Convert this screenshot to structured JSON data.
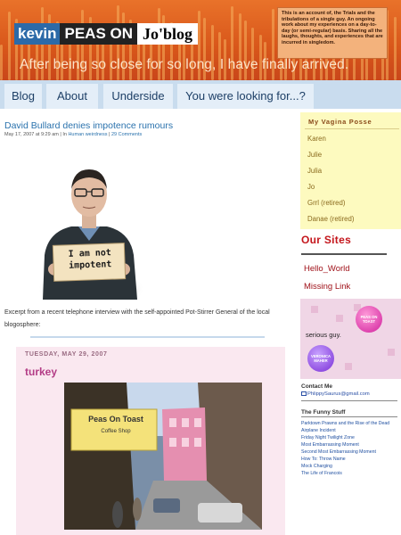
{
  "header": {
    "logo_kevin": "kevin",
    "logo_peas": "PEAS ON",
    "logo_jo": "Jo'blog",
    "tagline": "This is an account of, the Trials and the tribulations of a single guy. An ongoing work about my experiences on a day-to-day (or semi-regular) basis. Sharing all the laughs, thoughts, and experiences that are incurred in singledom.",
    "headline": "After being so close for so long, I have finally arrived."
  },
  "nav": {
    "tabs": [
      "Blog",
      "About",
      "Underside",
      "You were looking for...?"
    ]
  },
  "post": {
    "title": "David Bullard denies impotence rumours",
    "meta_date": "May 17, 2007 at 9:29 am | In ",
    "meta_category": "Human weirdness",
    "meta_sep": " | ",
    "meta_comments": "29 Comments",
    "sign_text": "I am not impotent",
    "excerpt": "Excerpt from a recent telephone interview with the self-appointed Pot-Stirrer General of the local blogosphere:"
  },
  "embed": {
    "date": "TUESDAY, MAY 29, 2007",
    "title": "turkey",
    "shop_sign": "Peas On Toast",
    "shop_sub": "Coffee Shop"
  },
  "sidebar": {
    "posse_title": "My Vagina Posse",
    "posse_items": [
      "Karen",
      "Julie",
      "Julia",
      "Jo",
      "Grrl (retired)",
      "Danae (retired)"
    ],
    "sites_title": "Our Sites",
    "sites": [
      "Hello_World",
      "Missing Link"
    ],
    "ad_text": "serious guy.",
    "badge_top": "PEAS ON TOAST",
    "badge_bottom": "VERONICA MAHER",
    "contact_title": "Contact Me",
    "contact_email": "PhlippySaurus@gmail.com",
    "funny_title": "The Funny Stuff",
    "funny_items": [
      "Parktown Prawns and the Rise of the Dead",
      "Airplane Incident",
      "Friday Night Twilight Zone",
      "Most Embarrassing Moment",
      "Second Most Embarrassing Moment",
      "How To: Throw Name",
      "Mock Charging",
      "The Life of Francois"
    ]
  },
  "colors": {
    "header_orange": "#d8561a",
    "link_blue": "#2a72ad",
    "sites_red": "#c4161c",
    "posse_bg": "#fdfabf",
    "embed_bg": "#fae8f0"
  }
}
